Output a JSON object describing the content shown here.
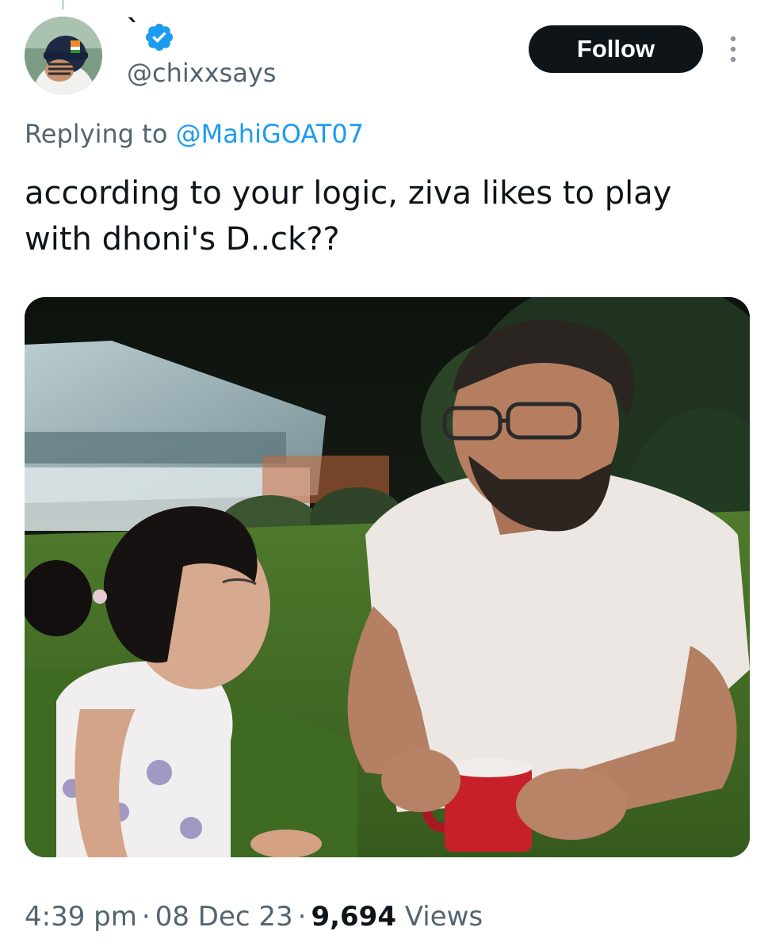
{
  "author": {
    "display_name": "`",
    "handle": "@chixxsays",
    "verified": true
  },
  "follow_button": {
    "label": "Follow"
  },
  "reply": {
    "prefix": "Replying to",
    "mention": "@MahiGOAT07"
  },
  "tweet": {
    "text": "according to your logic, ziva likes to play\nwith dhoni's D..ck??"
  },
  "meta": {
    "time": "4:39 pm",
    "date": "08 Dec 23",
    "separator": "·",
    "views_count": "9,694",
    "views_label": "Views"
  },
  "colors": {
    "accent": "#1d9bf0",
    "text_primary": "#0f1419",
    "text_secondary": "#536471",
    "button_bg": "#0f1419"
  },
  "icons": {
    "verified": "verified-badge-icon",
    "more": "more-dots-icon"
  }
}
